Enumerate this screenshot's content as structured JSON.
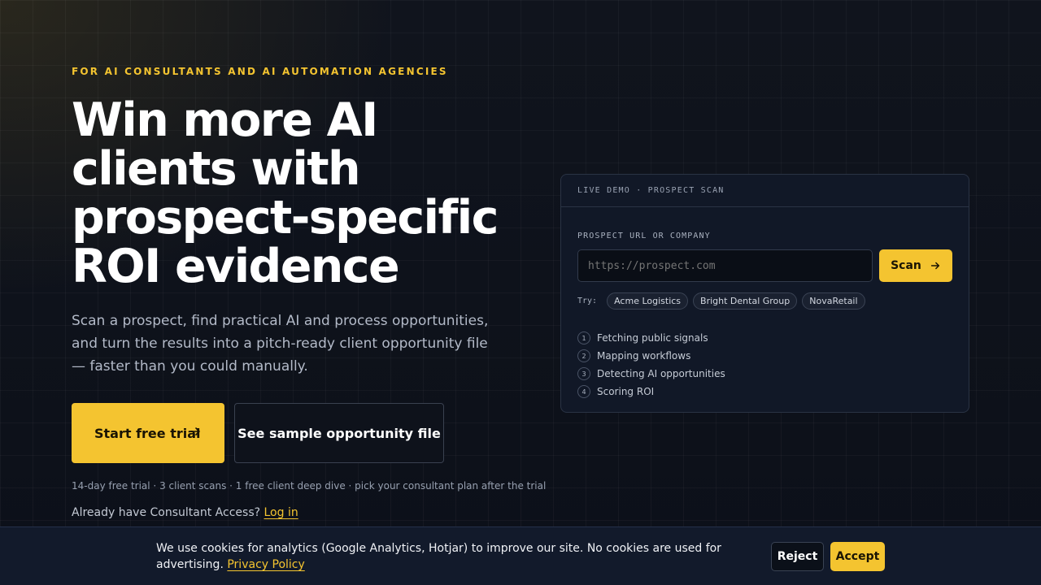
{
  "hero": {
    "eyebrow": "FOR AI CONSULTANTS AND AI AUTOMATION AGENCIES",
    "headline": "Win more AI clients with prospect-specific ROI evidence",
    "subheadline": "Scan a prospect, find practical AI and process opportunities, and turn the results into a pitch-ready client opportunity file — faster than you could manually.",
    "primary_cta": "Start free trial",
    "secondary_cta": "See sample opportunity file",
    "fineprint": "14-day free trial · 3 client scans · 1 free client deep dive · pick your consultant plan after the trial",
    "login_prompt": "Already have Consultant Access?",
    "login_link": "Log in"
  },
  "demo": {
    "header": "LIVE DEMO · PROSPECT SCAN",
    "field_label": "PROSPECT URL OR COMPANY",
    "input_placeholder": "https://prospect.com",
    "input_value": "",
    "scan_label": "Scan",
    "try_label": "Try:",
    "examples": [
      "Acme Logistics",
      "Bright Dental Group",
      "NovaRetail"
    ],
    "steps": [
      {
        "num": "1",
        "label": "Fetching public signals"
      },
      {
        "num": "2",
        "label": "Mapping workflows"
      },
      {
        "num": "3",
        "label": "Detecting AI opportunities"
      },
      {
        "num": "4",
        "label": "Scoring ROI"
      }
    ]
  },
  "cookie": {
    "text": "We use cookies for analytics (Google Analytics, Hotjar) to improve our site. No cookies are used for advertising.",
    "policy_link": "Privacy Policy",
    "reject": "Reject",
    "accept": "Accept"
  },
  "colors": {
    "accent": "#f4c430",
    "background": "#0d111b",
    "card": "#111827"
  },
  "icons": {
    "cta_arrow": "arrow-right-icon",
    "scan_arrow": "arrow-right-icon"
  }
}
